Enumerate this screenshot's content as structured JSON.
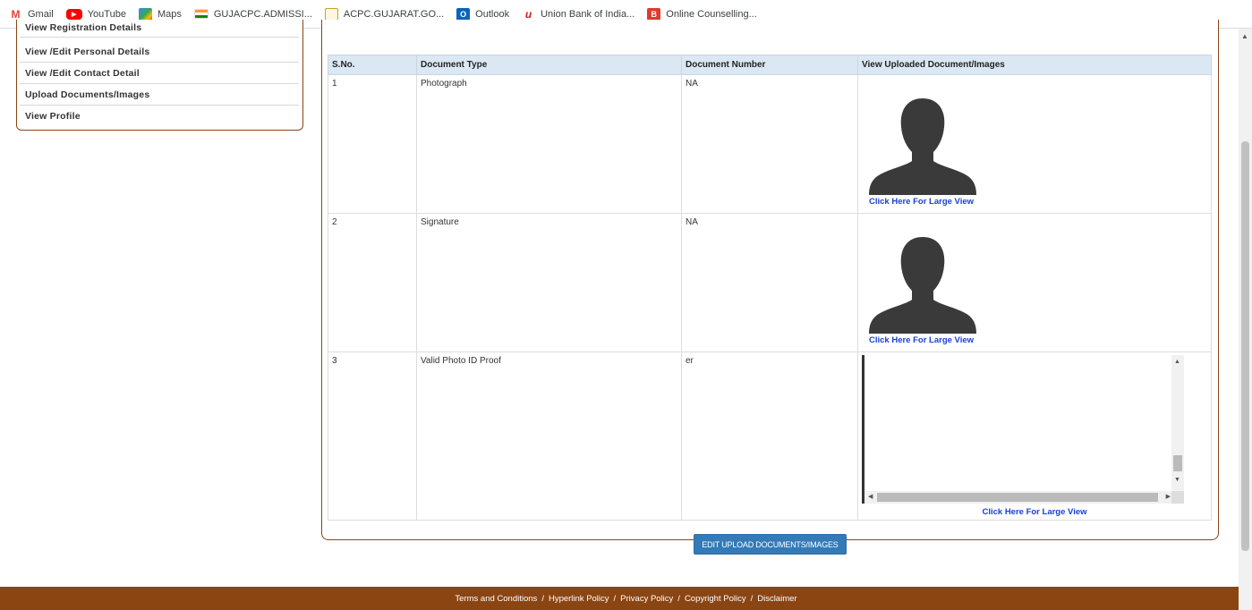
{
  "bookmarks": [
    {
      "label": "Gmail",
      "icon": "gmail-icon",
      "color": "#ea4335",
      "glyph": "M"
    },
    {
      "label": "YouTube",
      "icon": "youtube-icon",
      "color": "#ff0000",
      "glyph": "▶"
    },
    {
      "label": "Maps",
      "icon": "maps-icon",
      "color": "#34a853",
      "glyph": "◆"
    },
    {
      "label": "GUJACPC.ADMISSI...",
      "icon": "india-flag-icon",
      "color": "#ff9933",
      "glyph": ""
    },
    {
      "label": "ACPC.GUJARAT.GO...",
      "icon": "acpc-logo-icon",
      "color": "#c9a227",
      "glyph": ""
    },
    {
      "label": "Outlook",
      "icon": "outlook-icon",
      "color": "#0a64b8",
      "glyph": "O"
    },
    {
      "label": "Union Bank of India...",
      "icon": "union-bank-icon",
      "color": "#d71920",
      "glyph": "u"
    },
    {
      "label": "Online Counselling...",
      "icon": "counselling-icon",
      "color": "#e03a2f",
      "glyph": "B"
    }
  ],
  "sidebar": {
    "items": [
      {
        "label": "View Registration Details"
      },
      {
        "label": "View /Edit Personal Details"
      },
      {
        "label": "View /Edit Contact Detail"
      },
      {
        "label": "Upload Documents/Images"
      },
      {
        "label": "View Profile"
      }
    ]
  },
  "table": {
    "headers": [
      "S.No.",
      "Document Type",
      "Document Number",
      "View Uploaded Document/Images"
    ],
    "rows": [
      {
        "sno": "1",
        "type": "Photograph",
        "number": "NA",
        "link": "Click Here For Large View"
      },
      {
        "sno": "2",
        "type": "Signature",
        "number": "NA",
        "link": "Click Here For Large View"
      },
      {
        "sno": "3",
        "type": "Valid Photo ID Proof",
        "number": "er",
        "link": "Click Here For Large View"
      }
    ]
  },
  "edit_button": "EDIT UPLOAD DOCUMENTS/IMAGES",
  "footer": {
    "links": [
      "Terms and Conditions",
      "Hyperlink Policy",
      "Privacy Policy",
      "Copyright Policy",
      "Disclaimer"
    ]
  },
  "colors": {
    "accent_brown": "#8b4513",
    "button_blue": "#337ab7",
    "link_blue": "#1a3fd6",
    "header_bg": "#dbe8f3"
  }
}
